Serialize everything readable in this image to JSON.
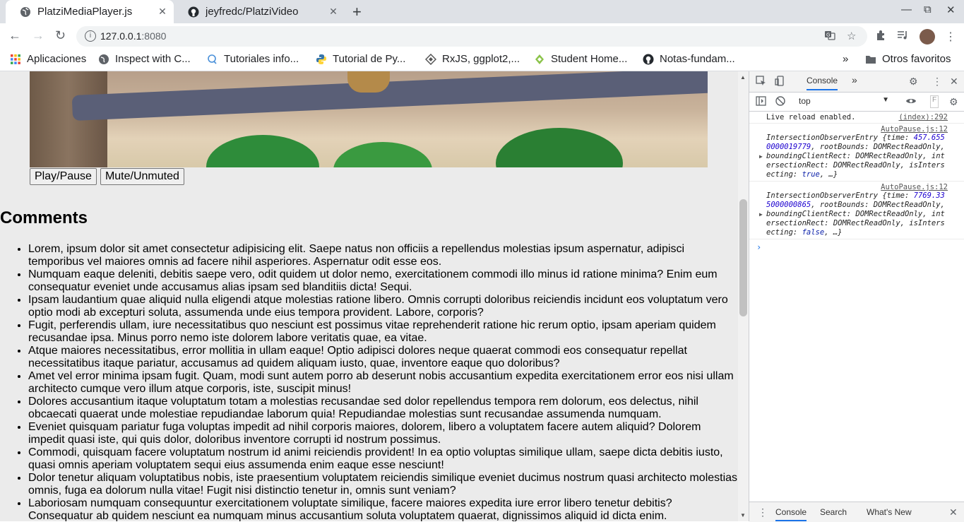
{
  "browser": {
    "tabs": [
      {
        "title": "PlatziMediaPlayer.js",
        "icon": "globe-icon"
      },
      {
        "title": "jeyfredc/PlatziVideo",
        "icon": "github-icon"
      }
    ],
    "url_host": "127.0.0.1",
    "url_port": ":8080",
    "bookmarks": [
      {
        "label": "Aplicaciones",
        "icon": "apps-grid-icon"
      },
      {
        "label": "Inspect with C...",
        "icon": "globe-icon"
      },
      {
        "label": "Tutoriales info...",
        "icon": "search-bubble-icon"
      },
      {
        "label": "Tutorial de Py...",
        "icon": "python-icon"
      },
      {
        "label": "RxJS, ggplot2,...",
        "icon": "diamond-icon"
      },
      {
        "label": "Student Home...",
        "icon": "leaf-icon"
      },
      {
        "label": "Notas-fundam...",
        "icon": "github-icon"
      }
    ],
    "other_bookmarks": "Otros favoritos",
    "overflow": "»"
  },
  "player": {
    "play_pause": "Play/Pause",
    "mute_unmute": "Mute/Unmuted"
  },
  "comments": {
    "title": "Comments",
    "items": [
      "Lorem, ipsum dolor sit amet consectetur adipisicing elit. Saepe natus non officiis a repellendus molestias ipsum aspernatur, adipisci temporibus vel maiores omnis ad facere nihil asperiores. Aspernatur odit esse eos.",
      "Numquam eaque deleniti, debitis saepe vero, odit quidem ut dolor nemo, exercitationem commodi illo minus id ratione minima? Enim eum consequatur eveniet unde accusamus alias ipsam sed blanditiis dicta! Sequi.",
      "Ipsam laudantium quae aliquid nulla eligendi atque molestias ratione libero. Omnis corrupti doloribus reiciendis incidunt eos voluptatum vero optio modi ab excepturi soluta, assumenda unde eius tempora provident. Labore, corporis?",
      "Fugit, perferendis ullam, iure necessitatibus quo nesciunt est possimus vitae reprehenderit ratione hic rerum optio, ipsam aperiam quidem recusandae ipsa. Minus porro nemo iste dolorem labore veritatis quae, ea vitae.",
      "Atque maiores necessitatibus, error mollitia in ullam eaque! Optio adipisci dolores neque quaerat commodi eos consequatur repellat necessitatibus itaque pariatur, accusamus ad quidem aliquam iusto, quae, inventore eaque quo doloribus?",
      "Amet vel error minima ipsam fugit. Quam, modi sunt autem porro ab deserunt nobis accusantium expedita exercitationem error eos nisi ullam architecto cumque vero illum atque corporis, iste, suscipit minus!",
      "Dolores accusantium itaque voluptatum totam a molestias recusandae sed dolor repellendus tempora rem dolorum, eos delectus, nihil obcaecati quaerat unde molestiae repudiandae laborum quia! Repudiandae molestias sunt recusandae assumenda numquam.",
      "Eveniet quisquam pariatur fuga voluptas impedit ad nihil corporis maiores, dolorem, libero a voluptatem facere autem aliquid? Dolorem impedit quasi iste, qui quis dolor, doloribus inventore corrupti id nostrum possimus.",
      "Commodi, quisquam facere voluptatum nostrum id animi reiciendis provident! In ea optio voluptas similique ullam, saepe dicta debitis iusto, quasi omnis aperiam voluptatem sequi eius assumenda enim eaque esse nesciunt!",
      "Dolor tenetur aliquam voluptatibus nobis, iste praesentium voluptatem reiciendis similique eveniet ducimus nostrum quasi architecto molestias omnis, fuga ea dolorum nulla vitae! Fugit nisi distinctio tenetur in, omnis sunt veniam?",
      "Laboriosam numquam consequuntur exercitationem voluptate similique, facere maiores expedita iure error libero tenetur debitis? Consequatur ab quidem nesciunt ea numquam minus accusantium soluta voluptatem quaerat, dignissimos aliquid id dicta enim."
    ]
  },
  "devtools": {
    "panel_tab": "Console",
    "more": "»",
    "context": "top",
    "filter_placeholder": "F",
    "messages": [
      {
        "text": "Live reload enabled.",
        "source": "(index):292"
      }
    ],
    "entries": [
      {
        "source": "AutoPause.js:12",
        "pre": "IntersectionObserverEntry {time: ",
        "time": "457.6550000019779",
        "mid": ", rootBounds: DOMRectReadOnly, boundingClientRect: DOMRectReadOnly, intersectionRect: DOMRectReadOnly, isIntersecting: ",
        "flag": "true",
        "post": ", …}"
      },
      {
        "source": "AutoPause.js:12",
        "pre": "IntersectionObserverEntry {time: ",
        "time": "7769.335000000865",
        "mid": ", rootBounds: DOMRectReadOnly, boundingClientRect: DOMRectReadOnly, intersectionRect: DOMRectReadOnly, isIntersecting: ",
        "flag": "false",
        "post": ", …}"
      }
    ],
    "prompt": "›",
    "drawer_tabs": [
      "Console",
      "Search",
      "What's New"
    ]
  }
}
